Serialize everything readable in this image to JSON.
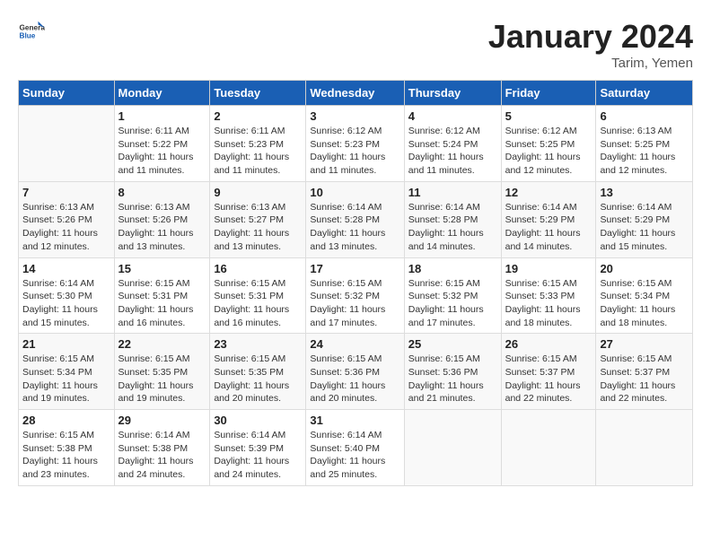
{
  "header": {
    "logo_general": "General",
    "logo_blue": "Blue",
    "month_title": "January 2024",
    "location": "Tarim, Yemen"
  },
  "days_of_week": [
    "Sunday",
    "Monday",
    "Tuesday",
    "Wednesday",
    "Thursday",
    "Friday",
    "Saturday"
  ],
  "weeks": [
    [
      {
        "num": "",
        "details": ""
      },
      {
        "num": "1",
        "details": "Sunrise: 6:11 AM\nSunset: 5:22 PM\nDaylight: 11 hours\nand 11 minutes."
      },
      {
        "num": "2",
        "details": "Sunrise: 6:11 AM\nSunset: 5:23 PM\nDaylight: 11 hours\nand 11 minutes."
      },
      {
        "num": "3",
        "details": "Sunrise: 6:12 AM\nSunset: 5:23 PM\nDaylight: 11 hours\nand 11 minutes."
      },
      {
        "num": "4",
        "details": "Sunrise: 6:12 AM\nSunset: 5:24 PM\nDaylight: 11 hours\nand 11 minutes."
      },
      {
        "num": "5",
        "details": "Sunrise: 6:12 AM\nSunset: 5:25 PM\nDaylight: 11 hours\nand 12 minutes."
      },
      {
        "num": "6",
        "details": "Sunrise: 6:13 AM\nSunset: 5:25 PM\nDaylight: 11 hours\nand 12 minutes."
      }
    ],
    [
      {
        "num": "7",
        "details": "Sunrise: 6:13 AM\nSunset: 5:26 PM\nDaylight: 11 hours\nand 12 minutes."
      },
      {
        "num": "8",
        "details": "Sunrise: 6:13 AM\nSunset: 5:26 PM\nDaylight: 11 hours\nand 13 minutes."
      },
      {
        "num": "9",
        "details": "Sunrise: 6:13 AM\nSunset: 5:27 PM\nDaylight: 11 hours\nand 13 minutes."
      },
      {
        "num": "10",
        "details": "Sunrise: 6:14 AM\nSunset: 5:28 PM\nDaylight: 11 hours\nand 13 minutes."
      },
      {
        "num": "11",
        "details": "Sunrise: 6:14 AM\nSunset: 5:28 PM\nDaylight: 11 hours\nand 14 minutes."
      },
      {
        "num": "12",
        "details": "Sunrise: 6:14 AM\nSunset: 5:29 PM\nDaylight: 11 hours\nand 14 minutes."
      },
      {
        "num": "13",
        "details": "Sunrise: 6:14 AM\nSunset: 5:29 PM\nDaylight: 11 hours\nand 15 minutes."
      }
    ],
    [
      {
        "num": "14",
        "details": "Sunrise: 6:14 AM\nSunset: 5:30 PM\nDaylight: 11 hours\nand 15 minutes."
      },
      {
        "num": "15",
        "details": "Sunrise: 6:15 AM\nSunset: 5:31 PM\nDaylight: 11 hours\nand 16 minutes."
      },
      {
        "num": "16",
        "details": "Sunrise: 6:15 AM\nSunset: 5:31 PM\nDaylight: 11 hours\nand 16 minutes."
      },
      {
        "num": "17",
        "details": "Sunrise: 6:15 AM\nSunset: 5:32 PM\nDaylight: 11 hours\nand 17 minutes."
      },
      {
        "num": "18",
        "details": "Sunrise: 6:15 AM\nSunset: 5:32 PM\nDaylight: 11 hours\nand 17 minutes."
      },
      {
        "num": "19",
        "details": "Sunrise: 6:15 AM\nSunset: 5:33 PM\nDaylight: 11 hours\nand 18 minutes."
      },
      {
        "num": "20",
        "details": "Sunrise: 6:15 AM\nSunset: 5:34 PM\nDaylight: 11 hours\nand 18 minutes."
      }
    ],
    [
      {
        "num": "21",
        "details": "Sunrise: 6:15 AM\nSunset: 5:34 PM\nDaylight: 11 hours\nand 19 minutes."
      },
      {
        "num": "22",
        "details": "Sunrise: 6:15 AM\nSunset: 5:35 PM\nDaylight: 11 hours\nand 19 minutes."
      },
      {
        "num": "23",
        "details": "Sunrise: 6:15 AM\nSunset: 5:35 PM\nDaylight: 11 hours\nand 20 minutes."
      },
      {
        "num": "24",
        "details": "Sunrise: 6:15 AM\nSunset: 5:36 PM\nDaylight: 11 hours\nand 20 minutes."
      },
      {
        "num": "25",
        "details": "Sunrise: 6:15 AM\nSunset: 5:36 PM\nDaylight: 11 hours\nand 21 minutes."
      },
      {
        "num": "26",
        "details": "Sunrise: 6:15 AM\nSunset: 5:37 PM\nDaylight: 11 hours\nand 22 minutes."
      },
      {
        "num": "27",
        "details": "Sunrise: 6:15 AM\nSunset: 5:37 PM\nDaylight: 11 hours\nand 22 minutes."
      }
    ],
    [
      {
        "num": "28",
        "details": "Sunrise: 6:15 AM\nSunset: 5:38 PM\nDaylight: 11 hours\nand 23 minutes."
      },
      {
        "num": "29",
        "details": "Sunrise: 6:14 AM\nSunset: 5:38 PM\nDaylight: 11 hours\nand 24 minutes."
      },
      {
        "num": "30",
        "details": "Sunrise: 6:14 AM\nSunset: 5:39 PM\nDaylight: 11 hours\nand 24 minutes."
      },
      {
        "num": "31",
        "details": "Sunrise: 6:14 AM\nSunset: 5:40 PM\nDaylight: 11 hours\nand 25 minutes."
      },
      {
        "num": "",
        "details": ""
      },
      {
        "num": "",
        "details": ""
      },
      {
        "num": "",
        "details": ""
      }
    ]
  ]
}
